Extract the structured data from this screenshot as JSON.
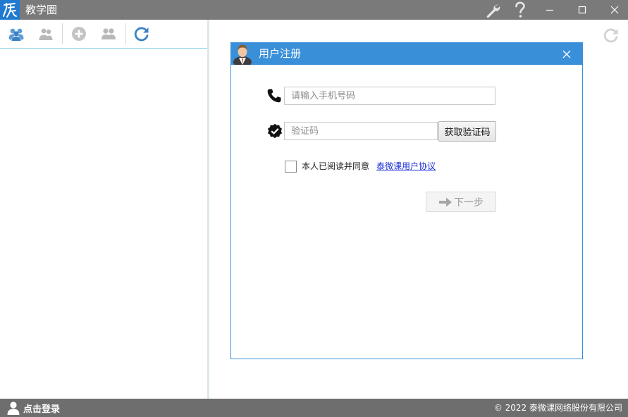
{
  "app": {
    "title": "教学圈",
    "accent_color": "#1f7ad0"
  },
  "titlebar": {
    "buttons": [
      {
        "name": "settings",
        "icon": "wrench-icon"
      },
      {
        "name": "help",
        "icon": "question-icon"
      },
      {
        "name": "minimize",
        "icon": "minimize-icon"
      },
      {
        "name": "maximize",
        "icon": "maximize-icon"
      },
      {
        "name": "close",
        "icon": "close-icon"
      }
    ]
  },
  "left_toolbar": {
    "buttons": [
      {
        "name": "group",
        "icon": "users-group-icon",
        "active": true
      },
      {
        "name": "contacts",
        "icon": "users-icon",
        "active": false
      },
      {
        "name": "add",
        "icon": "add-circle-icon",
        "active": false
      },
      {
        "name": "friends",
        "icon": "user-pair-icon",
        "active": false
      },
      {
        "name": "refresh",
        "icon": "refresh-icon",
        "active": true
      }
    ]
  },
  "dialog": {
    "title": "用户注册",
    "phone_placeholder": "请输入手机号码",
    "code_placeholder": "验证码",
    "get_code_label": "获取验证码",
    "agree_text": "本人已阅读并同意",
    "agreement_link": "泰微课用户协议",
    "next_label": "下一步",
    "header_color": "#3a8fd9"
  },
  "statusbar": {
    "login_label": "点击登录",
    "copyright": "© 2022 泰微课网络股份有限公司"
  }
}
